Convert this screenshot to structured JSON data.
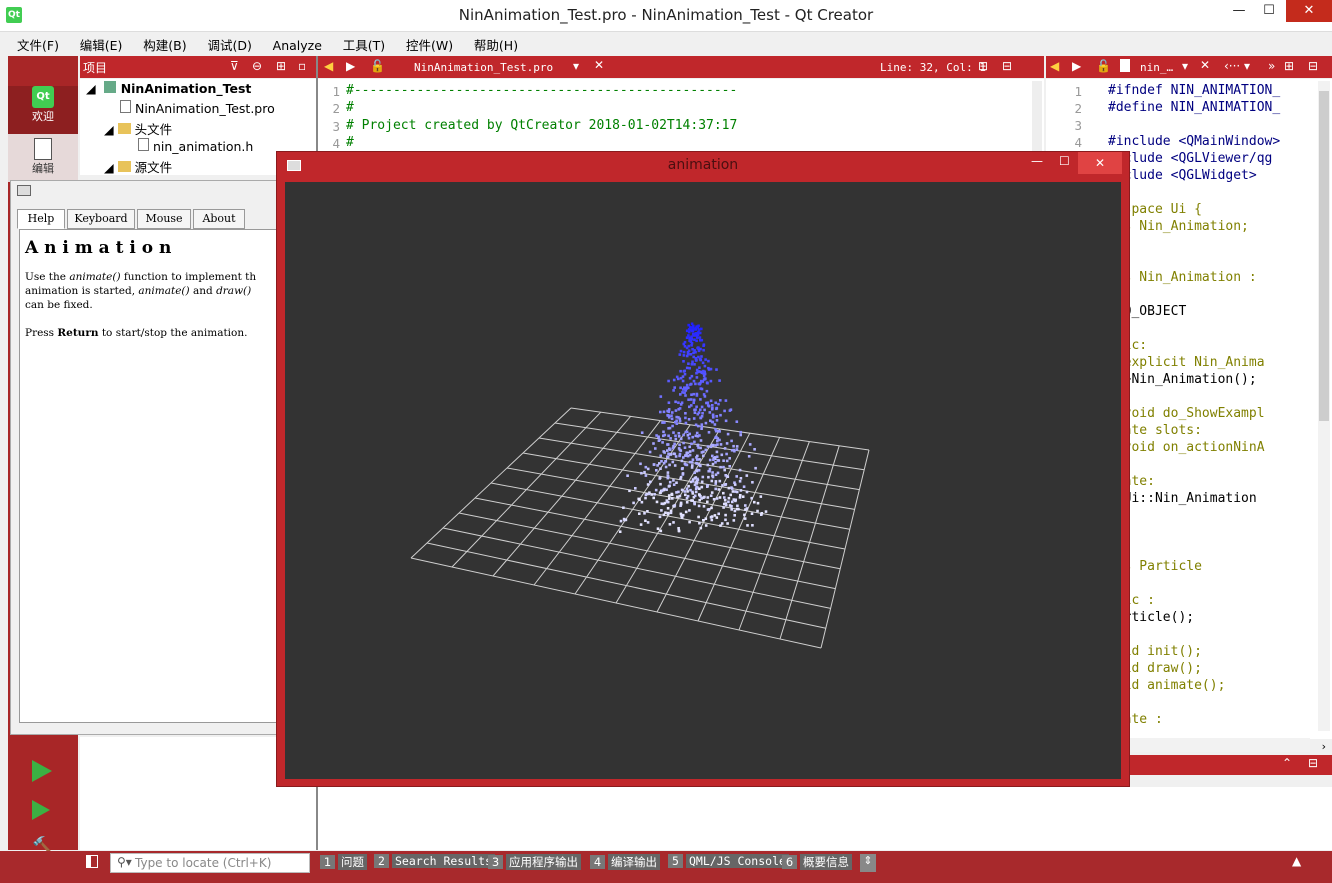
{
  "window": {
    "title": "NinAnimation_Test.pro - NinAnimation_Test - Qt Creator",
    "app_icon": "Qt"
  },
  "menu": [
    "文件(F)",
    "编辑(E)",
    "构建(B)",
    "调试(D)",
    "Analyze",
    "工具(T)",
    "控件(W)",
    "帮助(H)"
  ],
  "modes": {
    "welcome": "欢迎",
    "edit": "编辑",
    "qt_logo": "Qt"
  },
  "project_panel": {
    "title": "项目",
    "tree": [
      "NinAnimation_Test",
      "NinAnimation_Test.pro",
      "头文件",
      "nin_animation.h",
      "源文件"
    ]
  },
  "editor": {
    "file": "NinAnimation_Test.pro",
    "position": "Line: 32, Col: 1",
    "lines": [
      {
        "n": "1",
        "text": "#-------------------------------------------------"
      },
      {
        "n": "2",
        "text": "#"
      },
      {
        "n": "3",
        "text": "# Project created by QtCreator 2018-01-02T14:37:17"
      },
      {
        "n": "4",
        "text": "#"
      }
    ]
  },
  "editor2": {
    "file": "nin_…",
    "line_numbers": [
      "1",
      "2",
      "3",
      "4"
    ],
    "lines": [
      "#ifndef NIN_ANIMATION_",
      "#define NIN_ANIMATION_",
      "",
      "#include <QMainWindow>",
      "include <QGLViewer/qg",
      "include <QGLWidget>",
      "",
      "mespace Ui {",
      "ass Nin_Animation;",
      "",
      "",
      "ass Nin_Animation :",
      "",
      "  Q_OBJECT",
      "",
      "blic:",
      "  explicit Nin_Anima",
      "  ~Nin_Animation();",
      "",
      "  void do_ShowExampl",
      "ivate slots:",
      "  void on_actionNinA",
      "",
      "ivate:",
      "  Ui::Nin_Animation",
      "",
      "",
      "",
      "ass Particle",
      "",
      "blic :",
      "Particle();",
      "",
      "void init();",
      "void draw();",
      "void animate();",
      "",
      "ivate :"
    ]
  },
  "help": {
    "tabs": [
      "Help",
      "Keyboard",
      "Mouse",
      "About"
    ],
    "heading": "A n i m a t i o n",
    "p1a": "Use the ",
    "p1b": "animate()",
    "p1c": " function to implement th",
    "p2a": "animation is started, ",
    "p2b": "animate()",
    "p2c": " and ",
    "p2d": "draw()",
    "p3": "can be fixed.",
    "p4a": "Press ",
    "p4b": "Return",
    "p4c": " to start/stop the animation."
  },
  "animation_window": {
    "title": "animation"
  },
  "statusbar": {
    "locate_placeholder": "Type to locate (Ctrl+K)",
    "buttons": [
      {
        "n": "1",
        "label": "问题"
      },
      {
        "n": "2",
        "label": "Search Results"
      },
      {
        "n": "3",
        "label": "应用程序输出"
      },
      {
        "n": "4",
        "label": "编译输出"
      },
      {
        "n": "5",
        "label": "QML/JS Console"
      },
      {
        "n": "6",
        "label": "概要信息"
      }
    ]
  },
  "colors": {
    "accent": "#c0272b",
    "mode_bar": "#a82627",
    "canvas": "#333333"
  }
}
